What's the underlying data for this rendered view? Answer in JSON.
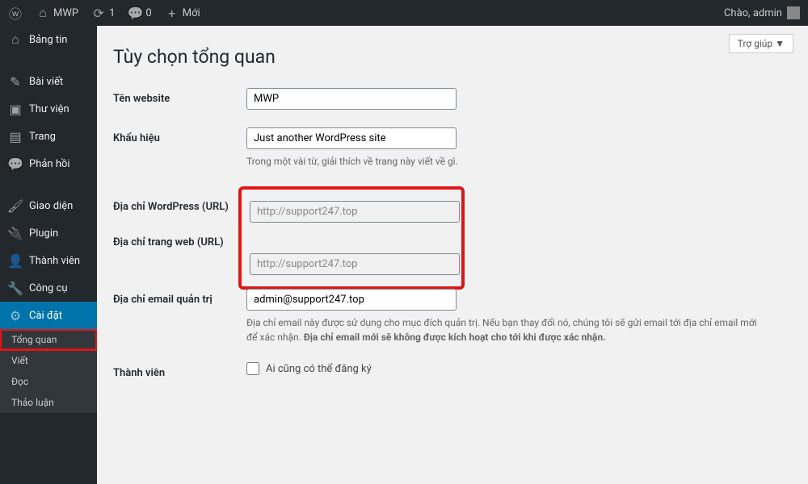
{
  "topbar": {
    "site_name": "MWP",
    "updates_count": "1",
    "comments_count": "0",
    "new_label": "Mới",
    "greeting": "Chào, admin"
  },
  "sidebar": {
    "items": [
      {
        "icon": "⌂",
        "label": "Bảng tin"
      },
      {
        "icon": "✎",
        "label": "Bài viết"
      },
      {
        "icon": "▣",
        "label": "Thư viện"
      },
      {
        "icon": "▤",
        "label": "Trang"
      },
      {
        "icon": "💬",
        "label": "Phản hồi"
      },
      {
        "icon": "🖌",
        "label": "Giao diện"
      },
      {
        "icon": "🔌",
        "label": "Plugin"
      },
      {
        "icon": "👤",
        "label": "Thành viên"
      },
      {
        "icon": "🔧",
        "label": "Công cụ"
      },
      {
        "icon": "⚙",
        "label": "Cài đặt"
      }
    ],
    "subitems": [
      {
        "label": "Tổng quan"
      },
      {
        "label": "Viết"
      },
      {
        "label": "Đọc"
      },
      {
        "label": "Thảo luận"
      }
    ]
  },
  "page": {
    "help_label": "Trợ giúp ▼",
    "title": "Tùy chọn tổng quan",
    "fields": {
      "site_title_label": "Tên website",
      "site_title_value": "MWP",
      "tagline_label": "Khẩu hiệu",
      "tagline_value": "Just another WordPress site",
      "tagline_desc": "Trong một vài từ, giải thích về trang này viết về gì.",
      "wp_url_label": "Địa chỉ WordPress (URL)",
      "wp_url_value": "http://support247.top",
      "site_url_label": "Địa chỉ trang web (URL)",
      "site_url_value": "http://support247.top",
      "admin_email_label": "Địa chỉ email quản trị",
      "admin_email_value": "admin@support247.top",
      "admin_email_desc_1": "Địa chỉ email này được sử dụng cho mục đích quản trị. Nếu bạn thay đổi nó, chúng tôi sẽ gửi email tới địa chỉ email mới để xác nhận. ",
      "admin_email_desc_2": "Địa chỉ email mới sẽ không được kích hoạt cho tới khi được xác nhận.",
      "membership_label": "Thành viên",
      "membership_checkbox": "Ai cũng có thể đăng ký"
    }
  }
}
